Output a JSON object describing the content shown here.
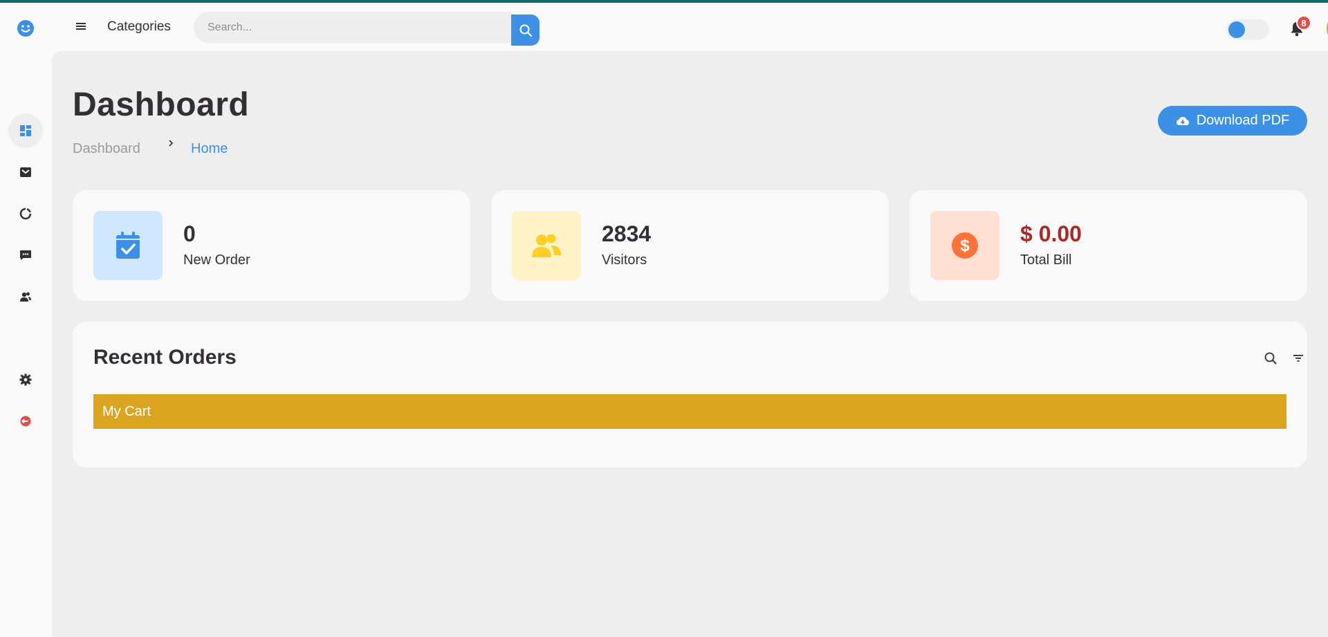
{
  "header": {
    "categories_label": "Categories",
    "search_placeholder": "Search...",
    "notification_count": "8",
    "theme_toggle": "on"
  },
  "sidebar": {
    "items": [
      {
        "name": "dashboard",
        "icon": "dashboard-icon",
        "active": true
      },
      {
        "name": "store",
        "icon": "store-icon",
        "active": false
      },
      {
        "name": "analytics",
        "icon": "pie-chart-icon",
        "active": false
      },
      {
        "name": "messages",
        "icon": "message-icon",
        "active": false
      },
      {
        "name": "team",
        "icon": "group-icon",
        "active": false
      },
      {
        "name": "settings",
        "icon": "gear-icon",
        "active": false
      },
      {
        "name": "logout",
        "icon": "logout-icon",
        "active": false
      }
    ]
  },
  "main": {
    "title": "Dashboard",
    "breadcrumb": [
      "Dashboard",
      "Home"
    ],
    "download_label": "Download PDF"
  },
  "stats": [
    {
      "value": "0",
      "label": "New Order",
      "icon": "calendar-check-icon",
      "icon_bg": "#cfe8ff",
      "icon_color": "#3c91e6",
      "value_color": "#342e37"
    },
    {
      "value": "2834",
      "label": "Visitors",
      "icon": "group-icon",
      "icon_bg": "#fff2c6",
      "icon_color": "#ffce26",
      "value_color": "#342e37"
    },
    {
      "value": "$ 0.00",
      "label": "Total Bill",
      "icon": "dollar-circle-icon",
      "icon_bg": "#ffe0d3",
      "icon_color": "#fd7238",
      "value_color": "#a52a2a"
    }
  ],
  "orders": {
    "title": "Recent Orders",
    "cart_label": "My Cart"
  },
  "colors": {
    "accent": "#3c91e6",
    "cart_bar": "#daa520",
    "badge": "#db504a",
    "top_line": "#0c6b6e"
  }
}
